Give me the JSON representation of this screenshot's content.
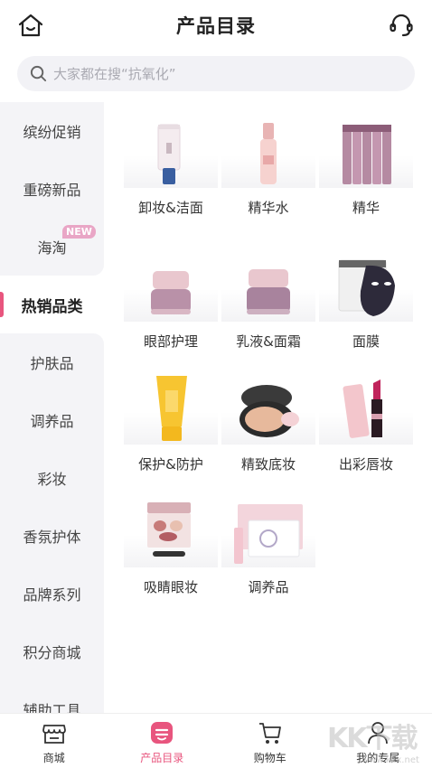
{
  "header": {
    "title": "产品目录",
    "home_icon": "home-smile-icon",
    "service_icon": "headset-icon"
  },
  "search": {
    "placeholder": "大家都在搜“抗氧化”"
  },
  "colors": {
    "accent": "#e8557e",
    "sidebar_bg": "#f4f4f7",
    "badge": "#e9a6c6"
  },
  "sidebar": {
    "items": [
      {
        "label": "缤纷促销"
      },
      {
        "label": "重磅新品"
      },
      {
        "label": "海淘",
        "badge": "NEW"
      },
      {
        "label": "热销品类",
        "active": true
      },
      {
        "label": "护肤品"
      },
      {
        "label": "调养品"
      },
      {
        "label": "彩妆"
      },
      {
        "label": "香氛护体"
      },
      {
        "label": "品牌系列"
      },
      {
        "label": "积分商城"
      },
      {
        "label": "辅助工具"
      }
    ]
  },
  "categories": [
    {
      "label": "卸妆&洁面",
      "icon": "cleanser-tube-icon"
    },
    {
      "label": "精华水",
      "icon": "essence-bottle-icon"
    },
    {
      "label": "精华",
      "icon": "serum-vials-icon"
    },
    {
      "label": "眼部护理",
      "icon": "eye-cream-jar-icon"
    },
    {
      "label": "乳液&面霜",
      "icon": "face-cream-jar-icon"
    },
    {
      "label": "面膜",
      "icon": "face-mask-icon"
    },
    {
      "label": "保护&防护",
      "icon": "sunscreen-tube-icon"
    },
    {
      "label": "精致底妆",
      "icon": "cushion-compact-icon"
    },
    {
      "label": "出彩唇妆",
      "icon": "lipstick-icon"
    },
    {
      "label": "吸睛眼妆",
      "icon": "eyeshadow-palette-icon"
    },
    {
      "label": "调养品",
      "icon": "supplement-box-icon"
    }
  ],
  "tabbar": [
    {
      "label": "商城",
      "icon": "store-icon"
    },
    {
      "label": "产品目录",
      "icon": "catalog-icon",
      "active": true
    },
    {
      "label": "购物车",
      "icon": "cart-icon"
    },
    {
      "label": "我的专属",
      "icon": "user-icon"
    }
  ],
  "watermark": {
    "text": "KK下载",
    "url": "www.kkx.net"
  }
}
